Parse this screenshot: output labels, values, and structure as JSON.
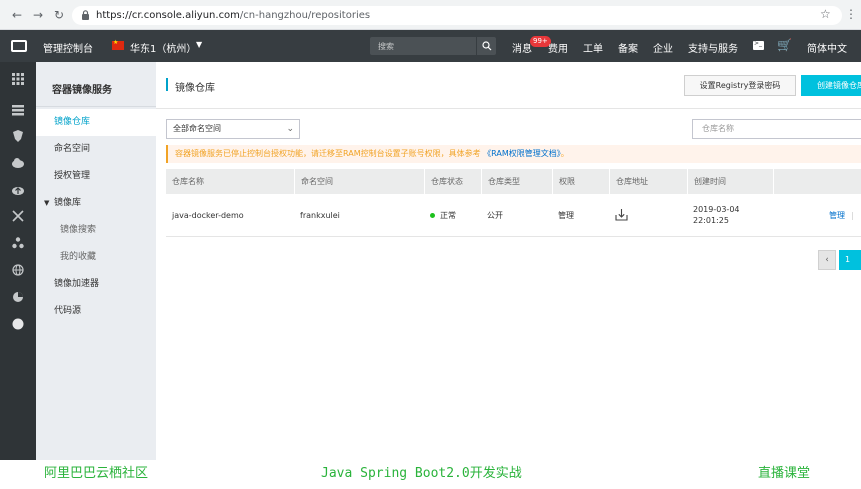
{
  "browser": {
    "url_host": "https://cr.console.aliyun.com",
    "url_path": "/cn-hangzhou/repositories"
  },
  "topnav": {
    "console_title": "管理控制台",
    "region": "华东1（杭州）",
    "search_placeholder": "搜索",
    "items": [
      "消息",
      "费用",
      "工单",
      "备案",
      "企业",
      "支持与服务"
    ],
    "message_badge": "99+",
    "language": "简体中文"
  },
  "sidebar": {
    "title": "容器镜像服务",
    "items": [
      {
        "label": "镜像仓库"
      },
      {
        "label": "命名空间"
      },
      {
        "label": "授权管理"
      },
      {
        "label": "镜像库"
      },
      {
        "label": "镜像搜索"
      },
      {
        "label": "我的收藏"
      },
      {
        "label": "镜像加速器"
      },
      {
        "label": "代码源"
      }
    ]
  },
  "main": {
    "title": "镜像仓库",
    "registry_button": "设置Registry登录密码",
    "create_button": "创建镜像仓库",
    "namespace_select": "全部命名空间",
    "name_placeholder": "仓库名称",
    "notice_text": "容器镜像服务已停止控制台授权功能，请迁移至RAM控制台设置子账号权限，具体参考",
    "notice_link": "《RAM权限管理文档》",
    "notice_end": "。",
    "table": {
      "headers": [
        "仓库名称",
        "命名空间",
        "仓库状态",
        "仓库类型",
        "权限",
        "仓库地址",
        "创建时间"
      ],
      "rows": [
        {
          "name": "java-docker-demo",
          "namespace": "frankxulei",
          "status": "正常",
          "type": "公开",
          "permission": "管理",
          "date": "2019-03-04",
          "time": "22:01:25",
          "action": "管理"
        }
      ]
    },
    "pagination": {
      "current": "1"
    }
  },
  "footer": {
    "left": "阿里巴巴云栖社区",
    "center": "Java Spring Boot2.0开发实战",
    "right": "直播课堂"
  }
}
